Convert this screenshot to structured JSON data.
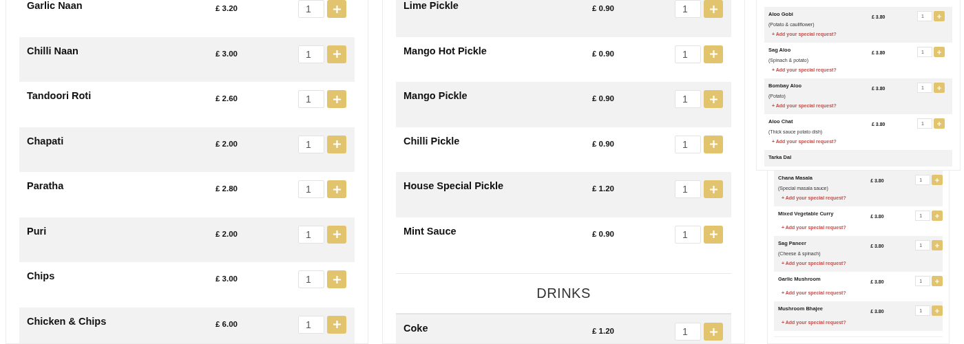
{
  "panels": [
    {
      "kind": "large",
      "items": [
        {
          "kind": "dish",
          "name": "Garlic Naan",
          "price": "£ 3.20",
          "quantity": "1",
          "shaded": false
        },
        {
          "kind": "dish",
          "name": "Chilli Naan",
          "price": "£ 3.00",
          "quantity": "1",
          "shaded": true
        },
        {
          "kind": "dish",
          "name": "Tandoori Roti",
          "price": "£ 2.60",
          "quantity": "1",
          "shaded": false
        },
        {
          "kind": "dish",
          "name": "Chapati",
          "price": "£ 2.00",
          "quantity": "1",
          "shaded": true
        },
        {
          "kind": "dish",
          "name": "Paratha",
          "price": "£ 2.80",
          "quantity": "1",
          "shaded": false
        },
        {
          "kind": "dish",
          "name": "Puri",
          "price": "£ 2.00",
          "quantity": "1",
          "shaded": true
        },
        {
          "kind": "dish",
          "name": "Chips",
          "price": "£ 3.00",
          "quantity": "1",
          "shaded": false
        },
        {
          "kind": "dish",
          "name": "Chicken & Chips",
          "price": "£ 6.00",
          "quantity": "1",
          "shaded": true
        }
      ]
    },
    {
      "kind": "large",
      "items": [
        {
          "kind": "dish",
          "name": "Lime Pickle",
          "price": "£ 0.90",
          "quantity": "1",
          "shaded": true
        },
        {
          "kind": "dish",
          "name": "Mango Hot Pickle",
          "price": "£ 0.90",
          "quantity": "1",
          "shaded": false
        },
        {
          "kind": "dish",
          "name": "Mango Pickle",
          "price": "£ 0.90",
          "quantity": "1",
          "shaded": true
        },
        {
          "kind": "dish",
          "name": "Chilli Pickle",
          "price": "£ 0.90",
          "quantity": "1",
          "shaded": false
        },
        {
          "kind": "dish",
          "name": "House Special Pickle",
          "price": "£ 1.20",
          "quantity": "1",
          "shaded": true
        },
        {
          "kind": "dish",
          "name": "Mint Sauce",
          "price": "£ 0.90",
          "quantity": "1",
          "shaded": false
        },
        {
          "kind": "heading",
          "title": "DRINKS"
        },
        {
          "kind": "dish",
          "name": "Coke",
          "price": "£ 1.20",
          "quantity": "1",
          "shaded": true
        }
      ]
    },
    {
      "kind": "small",
      "items": [
        {
          "kind": "dish",
          "name": "Aloo Gobi",
          "description": "(Potato & cauliflower)",
          "request": "+ Add your special request?",
          "price": "£ 3.80",
          "quantity": "1",
          "shaded": true
        },
        {
          "kind": "dish",
          "name": "Sag Aloo",
          "description": "(Spinach & potato)",
          "request": "+ Add your special request?",
          "price": "£ 3.80",
          "quantity": "1",
          "shaded": false
        },
        {
          "kind": "dish",
          "name": "Bombay Aloo",
          "description": "(Potato)",
          "request": "+ Add your special request?",
          "price": "£ 3.80",
          "quantity": "1",
          "shaded": true
        },
        {
          "kind": "dish",
          "name": "Aloo Chat",
          "description": "(Thick sauce potato dish)",
          "request": "+ Add your special request?",
          "price": "£ 3.80",
          "quantity": "1",
          "shaded": false
        },
        {
          "kind": "dish",
          "name": "Tarka Dal",
          "shaded": true
        }
      ]
    },
    {
      "kind": "small",
      "items": [
        {
          "kind": "dish",
          "name": "Chana Masala",
          "description": "(Special masala sauce)",
          "request": "+ Add your special request?",
          "price": "£ 3.80",
          "quantity": "1",
          "shaded": true
        },
        {
          "kind": "dish",
          "name": "Mixed Vegetable Curry",
          "request": "+ Add your special request?",
          "price": "£ 3.80",
          "quantity": "1",
          "shaded": false
        },
        {
          "kind": "dish",
          "name": "Sag Paneer",
          "description": "(Cheese & spinach)",
          "request": "+ Add your special request?",
          "price": "£ 3.80",
          "quantity": "1",
          "shaded": true
        },
        {
          "kind": "dish",
          "name": "Garlic Mushroom",
          "request": "+ Add your special request?",
          "price": "£ 3.80",
          "quantity": "1",
          "shaded": false
        },
        {
          "kind": "dish",
          "name": "Mushroom Bhajee",
          "request": "+ Add your special request?",
          "price": "£ 3.80",
          "quantity": "1",
          "shaded": true
        }
      ]
    }
  ]
}
